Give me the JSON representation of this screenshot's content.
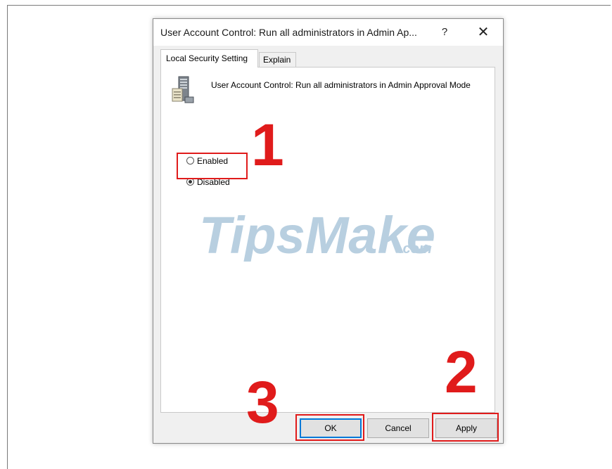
{
  "dialog": {
    "title": "User Account Control: Run all administrators in Admin Ap...",
    "help_label": "?",
    "close_label": "✕",
    "tabs": [
      {
        "label": "Local Security Setting"
      },
      {
        "label": "Explain"
      }
    ],
    "policy_name": "User Account Control: Run all administrators in Admin Approval Mode",
    "policy_icon": "server-policy-icon",
    "options": [
      {
        "label": "Enabled",
        "checked": false
      },
      {
        "label": "Disabled",
        "checked": true
      }
    ],
    "buttons": {
      "ok": "OK",
      "cancel": "Cancel",
      "apply": "Apply"
    }
  },
  "annotations": {
    "step1": "1",
    "step2": "2",
    "step3": "3",
    "highlight_color": "#e01b1b"
  },
  "watermark": {
    "brand": "TipsMake",
    "suffix": ".com"
  }
}
